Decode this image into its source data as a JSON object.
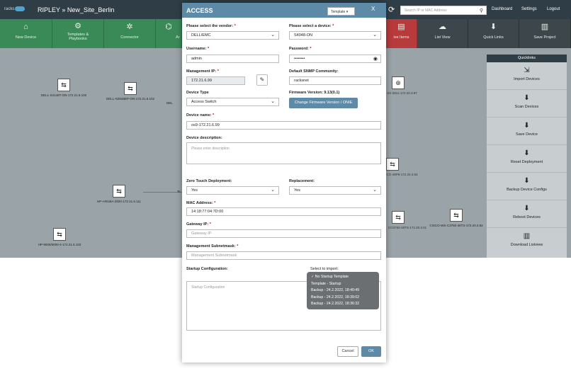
{
  "topbar": {
    "logo": "racks",
    "title": "RIPLEY » New_Site_Berlin",
    "search_placeholder": "Search IP or MAC Address",
    "nav": [
      "Dashboard",
      "Settings",
      "Logout"
    ]
  },
  "navrow": {
    "items": [
      {
        "label": "New Device",
        "icon": "⌂"
      },
      {
        "label": "Templates & Playbooks",
        "icon": "⚙"
      },
      {
        "label": "Connector",
        "icon": "✲"
      },
      {
        "label": "Ar",
        "icon": "⌬"
      },
      {
        "label": "ive Items",
        "icon": "▤"
      },
      {
        "label": "List View",
        "icon": "☁"
      },
      {
        "label": "Quick Links",
        "icon": "⬇"
      },
      {
        "label": "Save Project",
        "icon": "▥"
      }
    ]
  },
  "canvas": {
    "nodes": [
      "DELL-S4148T-ON-172.21.6.100",
      "DELL-N3048EP-ON-172.21.6.102",
      "DEL",
      "HP-ARUBA-2920-172.21.6.111",
      "HP-9000/6000-4-172.21.6.102",
      "SS-2811-172.20.3.97",
      "CO-48P8-172.20.3.93",
      "CO3750-48TS-172.20.3.01",
      "CISCO-WS-C3750-48TS-172.20.3.92",
      "Te"
    ]
  },
  "quicklinks": {
    "title": "Quicklinks",
    "items": [
      "Import Devices",
      "Scan Devices",
      "Save Device",
      "Reset Deployment",
      "Backup Device Configs",
      "Reboot Devices",
      "Download Listview"
    ]
  },
  "modal": {
    "title": "ACCESS",
    "template_button": "Template",
    "close": "X",
    "vendor_label": "Please select the vendor:",
    "vendor_value": "DELL/EMC",
    "device_label": "Please select a device:",
    "device_value": "S4048-ON",
    "username_label": "Username:",
    "username_value": "admin",
    "password_label": "Password:",
    "password_value": "••••••••",
    "mgmt_ip_label": "Management IP:",
    "mgmt_ip_value": "172.21.6.99",
    "snmp_label": "Default SNMP Community:",
    "snmp_value": "racksnet",
    "device_type_label": "Device Type",
    "device_type_value": "Access Switch",
    "firmware_label": "Firmware Version: 9.13(0.1)",
    "firmware_button": "Change Firmware Version / ONIE",
    "device_name_label": "Device name:",
    "device_name_value": "os9-172.21.6.99",
    "desc_label": "Device description:",
    "desc_placeholder": "Please enter description",
    "ztd_label": "Zero Touch Deployment:",
    "ztd_value": "Yes",
    "replacement_label": "Replacement:",
    "replacement_value": "Yes",
    "mac_label": "MAC Address:",
    "mac_value": "14:18:77:04:7D:00",
    "gateway_label": "Gateway IP:",
    "gateway_placeholder": "Gateway IP",
    "subnet_label": "Management Subnetmask:",
    "subnet_placeholder": "Management Subnetmask",
    "startup_label": "Startup Configuration:",
    "import_label": "Select to import:",
    "startup_placeholder": "Startup Configuration",
    "cancel": "Cancel",
    "ok": "OK"
  },
  "import_options": [
    "✓ No Startup Template",
    "Template - Startup",
    "Backup - 24.2.2022, 18:40:49",
    "Backup - 24.2.2022, 18:39:02",
    "Backup - 24.2.2022, 18:36:32"
  ]
}
